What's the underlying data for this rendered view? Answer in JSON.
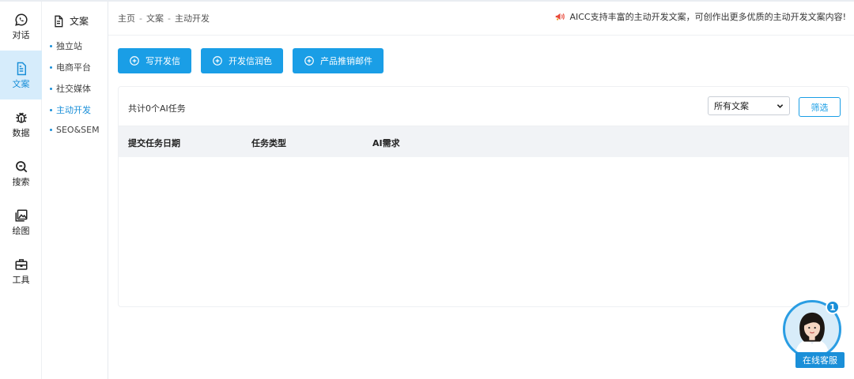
{
  "rail": [
    {
      "label": "对话",
      "icon": "chat-icon"
    },
    {
      "label": "文案",
      "icon": "document-icon",
      "active": true
    },
    {
      "label": "数据",
      "icon": "bug-icon"
    },
    {
      "label": "搜索",
      "icon": "search-icon"
    },
    {
      "label": "绘图",
      "icon": "image-icon"
    },
    {
      "label": "工具",
      "icon": "toolbox-icon"
    }
  ],
  "subnav": {
    "title": "文案",
    "items": [
      {
        "label": "独立站"
      },
      {
        "label": "电商平台"
      },
      {
        "label": "社交媒体"
      },
      {
        "label": "主动开发",
        "active": true
      },
      {
        "label": "SEO&SEM"
      }
    ]
  },
  "breadcrumb": [
    "主页",
    "文案",
    "主动开发"
  ],
  "breadcrumb_sep": "-",
  "notice": "AICC支持丰富的主动开发文案，可创作出更多优质的主动开发文案内容!",
  "actions": {
    "write_letter": "写开发信",
    "polish_letter": "开发信润色",
    "promo_email": "产品推销邮件"
  },
  "panel": {
    "count_text": "共计0个AI任务",
    "select_value": "所有文案",
    "filter_label": "筛选",
    "columns": [
      "提交任务日期",
      "任务类型",
      "AI需求"
    ]
  },
  "support": {
    "badge": "1",
    "label": "在线客服"
  },
  "colors": {
    "accent": "#1a9ee6",
    "active_bg": "#d6ecfb",
    "table_head_bg": "#f1f3f6"
  }
}
